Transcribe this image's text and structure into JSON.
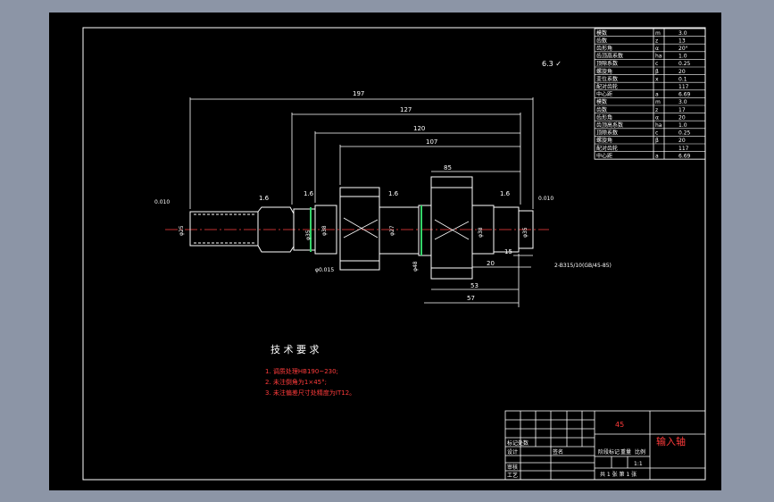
{
  "drawing": {
    "part_name": "输入轴",
    "material": "45",
    "surface_mark": "6.3 ✓",
    "tech_title": "技 术 要 求",
    "tech_notes": [
      "1. 调质处理HB190~230;",
      "2. 未注倒角为1×45°;",
      "3. 未注偏差尺寸处精度为IT12。"
    ],
    "dimensions": {
      "d197": "197",
      "d127": "127",
      "d120": "120",
      "d107": "107",
      "d85": "85",
      "d53": "53",
      "d57": "57",
      "d20": "20",
      "d15": "15",
      "rough1": "1.6",
      "rough2": "1.6",
      "rough3": "1.6",
      "rough4": "1.6",
      "dia_left": "φ25",
      "dia_mid1": "φ35",
      "dia_mid2": "φ38",
      "dia_mid3": "φ27",
      "dia_right1": "φ38",
      "dia_right2": "φ35",
      "dia_gear": "φ48",
      "spline_callout": "2-B315/10(GB/45-85)",
      "tol_left": "0.010",
      "tol_right": "0.010",
      "tol_box": "φ0.015"
    },
    "gear_table": [
      {
        "name": "模数",
        "sym": "m",
        "val": "3.0"
      },
      {
        "name": "齿数",
        "sym": "z",
        "val": "13"
      },
      {
        "name": "齿形角",
        "sym": "α",
        "val": "20°"
      },
      {
        "name": "齿顶高系数",
        "sym": "ha",
        "val": "1.0"
      },
      {
        "name": "顶隙系数",
        "sym": "c",
        "val": "0.25"
      },
      {
        "name": "螺旋角",
        "sym": "β",
        "val": "20"
      },
      {
        "name": "变位系数",
        "sym": "x",
        "val": "0.1"
      },
      {
        "name": "配对齿轮",
        "sym": "",
        "val": "117"
      },
      {
        "name": "中心距",
        "sym": "a",
        "val": "6.69"
      },
      {
        "name": "模数",
        "sym": "m",
        "val": "3.0"
      },
      {
        "name": "齿数",
        "sym": "z",
        "val": "17"
      },
      {
        "name": "齿形角",
        "sym": "α",
        "val": "20"
      },
      {
        "name": "齿顶高系数",
        "sym": "ha",
        "val": "1.0"
      },
      {
        "name": "顶隙系数",
        "sym": "c",
        "val": "0.25"
      },
      {
        "name": "螺旋角",
        "sym": "β",
        "val": "20"
      },
      {
        "name": "配对齿轮",
        "sym": "",
        "val": "117"
      },
      {
        "name": "中心距",
        "sym": "a",
        "val": "6.69"
      }
    ],
    "title_block": {
      "design": "设计",
      "check": "审核",
      "process": "工艺",
      "mark_label": "标记处数",
      "sign_label": "签名",
      "stage_label": "阶段标记",
      "weight_label": "重量",
      "scale_label": "比例",
      "scale": "1:1",
      "sheets": "共 1 张   第 1 张"
    }
  }
}
